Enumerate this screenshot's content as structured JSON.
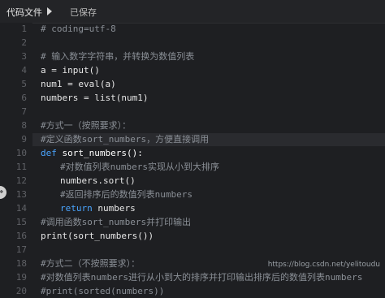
{
  "toolbar": {
    "file_label": "代码文件",
    "run_icon": "play-icon",
    "status": "已保存"
  },
  "editor": {
    "lines": [
      {
        "n": "1",
        "text": "# coding=utf-8",
        "type": "comment",
        "indent": 0
      },
      {
        "n": "2",
        "text": "",
        "type": "plain",
        "indent": 0
      },
      {
        "n": "3",
        "text": "# 输入数字字符串，并转换为数值列表",
        "type": "comment",
        "indent": 0
      },
      {
        "n": "4",
        "text": "a = input()",
        "type": "plain",
        "indent": 0
      },
      {
        "n": "5",
        "text": "num1 = eval(a)",
        "type": "plain",
        "indent": 0
      },
      {
        "n": "6",
        "text": "numbers = list(num1)",
        "type": "plain",
        "indent": 0
      },
      {
        "n": "7",
        "text": "",
        "type": "plain",
        "indent": 0
      },
      {
        "n": "8",
        "text": "#方式一（按照要求）：",
        "type": "comment",
        "indent": 0
      },
      {
        "n": "9",
        "text": "#定义函数sort_numbers，方便直接调用",
        "type": "comment",
        "indent": 0
      },
      {
        "n": "10",
        "text": "def sort_numbers():",
        "type": "def",
        "indent": 0
      },
      {
        "n": "11",
        "text": "#对数值列表numbers实现从小到大排序",
        "type": "comment",
        "indent": 1
      },
      {
        "n": "12",
        "text": "numbers.sort()",
        "type": "plain",
        "indent": 1
      },
      {
        "n": "13",
        "text": "#返回排序后的数值列表numbers",
        "type": "comment",
        "indent": 1
      },
      {
        "n": "14",
        "text": "return numbers",
        "type": "return",
        "indent": 1
      },
      {
        "n": "15",
        "text": "#调用函数sort_numbers并打印输出",
        "type": "comment",
        "indent": 0
      },
      {
        "n": "16",
        "text": "print(sort_numbers())",
        "type": "plain",
        "indent": 0
      },
      {
        "n": "17",
        "text": "",
        "type": "plain",
        "indent": 0
      },
      {
        "n": "18",
        "text": "#方式二（不按照要求）：",
        "type": "comment",
        "indent": 0
      },
      {
        "n": "19",
        "text": "#对数值列表numbers进行从小到大的排序并打印输出排序后的数值列表numbers",
        "type": "comment",
        "indent": 0
      },
      {
        "n": "20",
        "text": "#print(sorted(numbers))",
        "type": "comment",
        "indent": 0
      }
    ]
  },
  "side_toggle": {
    "glyph": "⇔",
    "icon": "collapse-arrow-icon"
  },
  "watermark": "https://blog.csdn.net/yelitoudu"
}
